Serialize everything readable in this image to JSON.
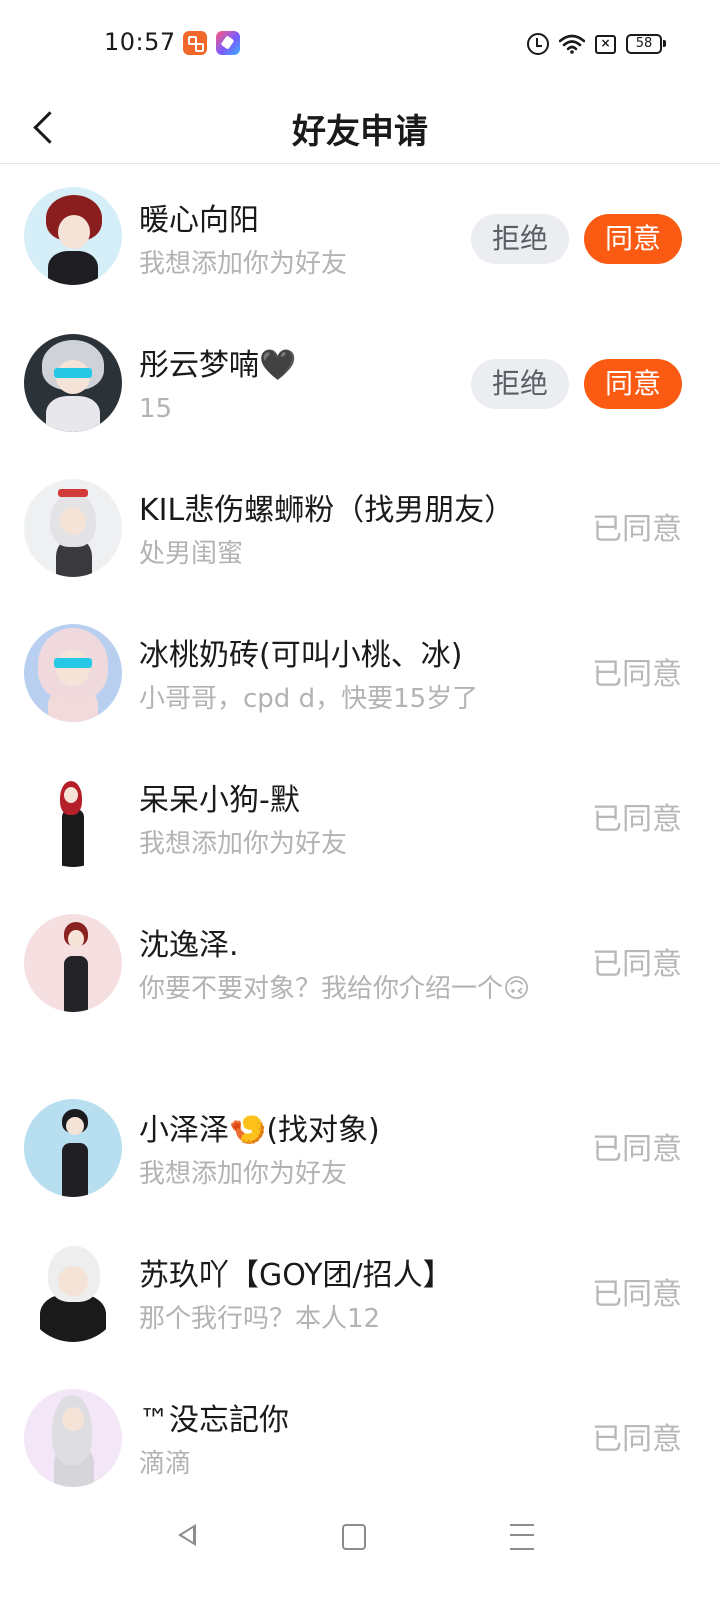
{
  "status_bar": {
    "time": "10:57",
    "battery": "58",
    "icons": [
      "app-orange-icon",
      "app-gradient-icon",
      "alarm-icon",
      "wifi-icon",
      "sim-x-icon",
      "battery-icon"
    ]
  },
  "header": {
    "title": "好友申请",
    "back_icon": "chevron-left-icon"
  },
  "buttons": {
    "reject": "拒绝",
    "accept": "同意",
    "accepted": "已同意"
  },
  "colors": {
    "accent": "#fb5a12",
    "reject_bg": "#ebedf1",
    "muted_text": "#b3b3b3"
  },
  "requests": [
    {
      "name": "暖心向阳",
      "message": "我想添加你为好友",
      "status": "pending"
    },
    {
      "name": "彤云梦喃🖤",
      "message": "15",
      "status": "pending"
    },
    {
      "name": "KIL悲伤螺蛳粉（找男朋友）",
      "message": "处男闺蜜",
      "status": "accepted"
    },
    {
      "name": "冰桃奶砖(可叫小桃、冰)",
      "message": "小哥哥，cpd d，快要15岁了",
      "status": "accepted"
    },
    {
      "name": "呆呆小狗-默",
      "message": "我想添加你为好友",
      "status": "accepted"
    },
    {
      "name": "沈逸泽.",
      "message": "你要不要对象？我给你介绍一个🙃",
      "status": "accepted"
    },
    {
      "name": "小泽泽🍤(找对象)",
      "message": "我想添加你为好友",
      "status": "accepted"
    },
    {
      "name": "苏玖吖【GOY团/招人】",
      "message": "那个我行吗？本人12",
      "status": "accepted"
    },
    {
      "name": "™没忘記你",
      "message": "滴滴",
      "status": "accepted"
    }
  ],
  "nav_bar": {
    "icons": [
      "nav-back-icon",
      "nav-home-icon",
      "nav-menu-icon"
    ]
  }
}
